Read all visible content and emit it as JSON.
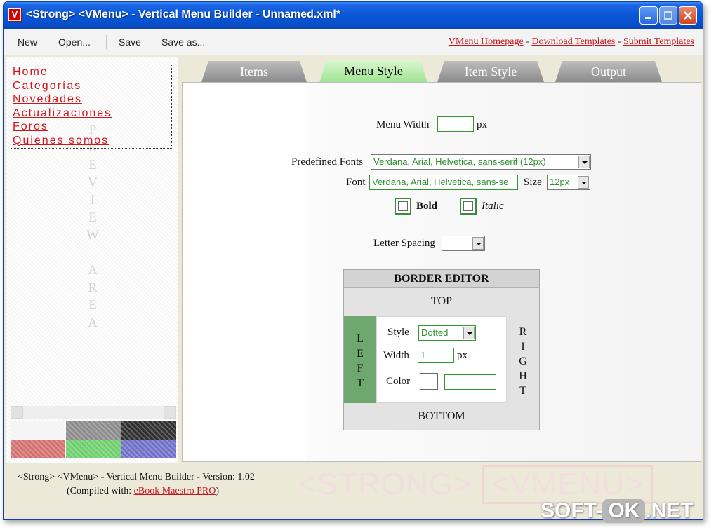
{
  "window": {
    "title": "<Strong> <VMenu> - Vertical Menu Builder - Unnamed.xml*",
    "icon_letter": "V"
  },
  "toolbar": {
    "new_label": "New",
    "open_label": "Open...",
    "save_label": "Save",
    "save_as_label": "Save as...",
    "links": [
      "VMenu Homepage",
      "Download Templates",
      "Submit Templates"
    ],
    "link_separator": "-"
  },
  "preview": {
    "menu_items": [
      "Home",
      "Categorías",
      "Novedades",
      "Actualizaciones",
      "Foros",
      "Quienes somos"
    ],
    "watermark": [
      "P",
      "R",
      "E",
      "V",
      "I",
      "E",
      "W",
      "",
      "A",
      "R",
      "E",
      "A"
    ],
    "swatch_colors": [
      "#f4f4f4",
      "#8c8c8c",
      "#2f2f2f",
      "#d47070",
      "#6fcf6f",
      "#7070c8"
    ]
  },
  "tabs": [
    "Items",
    "Menu Style",
    "Item Style",
    "Output"
  ],
  "active_tab": "Menu Style",
  "menu_style": {
    "menu_width_label": "Menu Width",
    "menu_width_value": "",
    "menu_width_unit": "px",
    "predefined_fonts_label": "Predefined Fonts",
    "predefined_fonts_value": "Verdana, Arial, Helvetica, sans-serif (12px)",
    "font_label": "Font",
    "font_value": "Verdana, Arial, Helvetica, sans-se",
    "size_label": "Size",
    "size_value": "12px",
    "bold_label": "Bold",
    "bold_checked": false,
    "italic_label": "Italic",
    "italic_checked": false,
    "letter_spacing_label": "Letter Spacing",
    "letter_spacing_value": ""
  },
  "border_editor": {
    "title": "BORDER EDITOR",
    "top_label": "TOP",
    "bottom_label": "BOTTOM",
    "left_label": [
      "L",
      "E",
      "F",
      "T"
    ],
    "right_label": [
      "R",
      "I",
      "G",
      "H",
      "T"
    ],
    "style_label": "Style",
    "style_value": "Dotted",
    "width_label": "Width",
    "width_value": "1",
    "width_unit": "px",
    "color_label": "Color",
    "color_value": ""
  },
  "footer": {
    "line1": "<Strong> <VMenu> - Vertical Menu Builder - Version: 1.02",
    "line2_prefix": "(Compiled with: ",
    "line2_link": "eBook Maestro PRO",
    "line2_suffix": ")",
    "watermark_left": "<STRONG>",
    "watermark_right": "<VMENU>"
  },
  "site_watermark": {
    "left": "SOFT-",
    "middle": "OK",
    "right": ".NET"
  },
  "colors": {
    "titlebar": "#0a58d8",
    "link_red": "#c8171c",
    "active_tab": "#9ee390",
    "input_border": "#2e9a2e",
    "left_border_green": "#6fa86f"
  }
}
